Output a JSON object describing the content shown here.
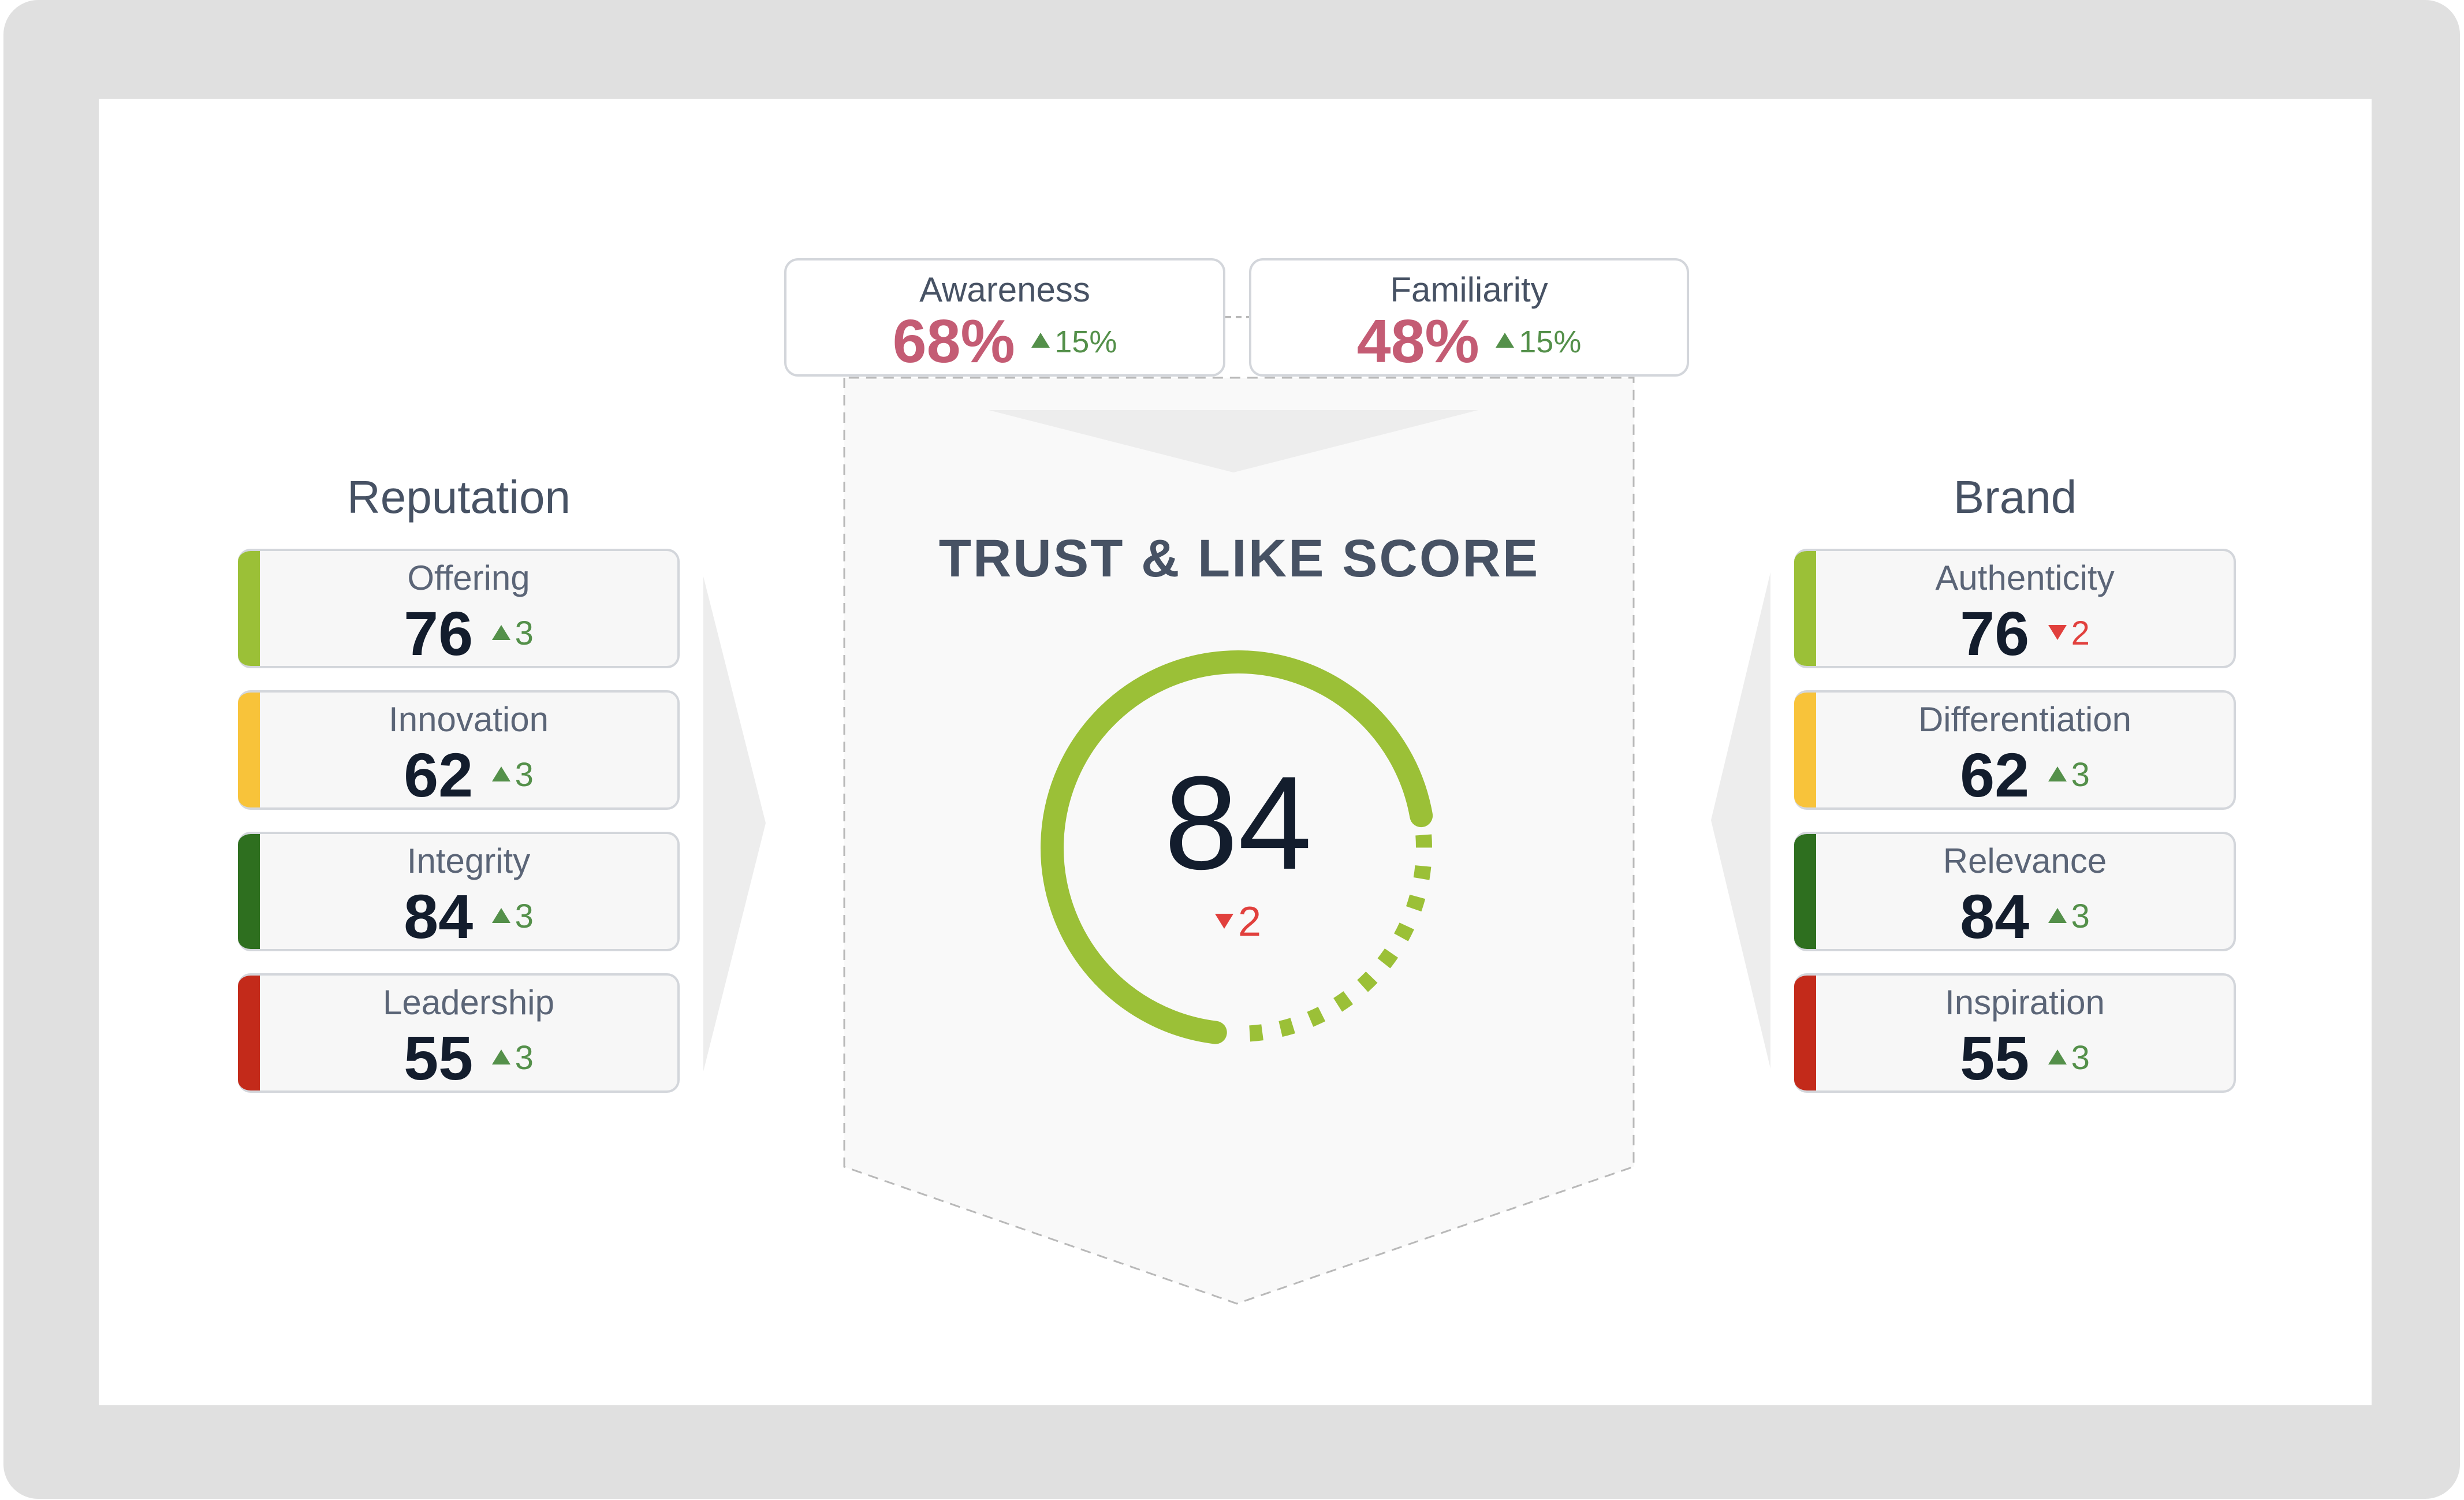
{
  "colors": {
    "frame": "#e0e0e0",
    "stripe_lime": "#9bc037",
    "stripe_amber": "#f8c33a",
    "stripe_dark_green": "#2e6f1f",
    "stripe_red": "#c32a1a",
    "up": "#54904a",
    "down": "#e1403d",
    "percent": "#c45c74",
    "gauge": "#9bc037"
  },
  "top_metrics": [
    {
      "label": "Awareness",
      "value": "68%",
      "delta": "15%",
      "direction": "up"
    },
    {
      "label": "Familiarity",
      "value": "48%",
      "delta": "15%",
      "direction": "up"
    }
  ],
  "score": {
    "title": "TRUST & LIKE SCORE",
    "value": "84",
    "delta": "2",
    "direction": "down",
    "gauge_fraction": 0.84
  },
  "reputation": {
    "title": "Reputation",
    "items": [
      {
        "label": "Offering",
        "value": "76",
        "delta": "3",
        "direction": "up",
        "stripe": "lime"
      },
      {
        "label": "Innovation",
        "value": "62",
        "delta": "3",
        "direction": "up",
        "stripe": "amber"
      },
      {
        "label": "Integrity",
        "value": "84",
        "delta": "3",
        "direction": "up",
        "stripe": "dark_green"
      },
      {
        "label": "Leadership",
        "value": "55",
        "delta": "3",
        "direction": "up",
        "stripe": "red"
      }
    ]
  },
  "brand": {
    "title": "Brand",
    "items": [
      {
        "label": "Authenticity",
        "value": "76",
        "delta": "2",
        "direction": "down",
        "stripe": "lime"
      },
      {
        "label": "Differentiation",
        "value": "62",
        "delta": "3",
        "direction": "up",
        "stripe": "amber"
      },
      {
        "label": "Relevance",
        "value": "84",
        "delta": "3",
        "direction": "up",
        "stripe": "dark_green"
      },
      {
        "label": "Inspiration",
        "value": "55",
        "delta": "3",
        "direction": "up",
        "stripe": "red"
      }
    ]
  }
}
